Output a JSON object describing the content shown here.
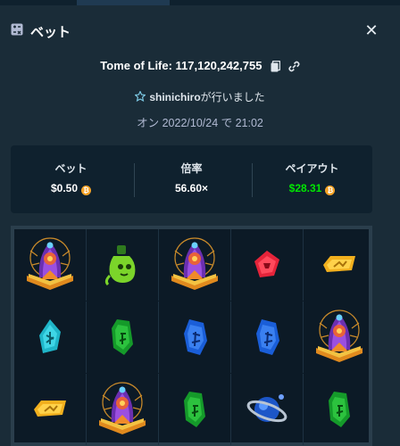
{
  "header": {
    "title": "ベット",
    "close_glyph": "✕"
  },
  "game": {
    "title": "Tome of Life: 117,120,242,755"
  },
  "user": {
    "name": "shinichiro",
    "suffix": "が行いました"
  },
  "date": {
    "text": "オン 2022/10/24 で 21:02"
  },
  "stats": {
    "bet": {
      "label": "ベット",
      "value": "$0.50"
    },
    "multiplier": {
      "label": "倍率",
      "value": "56.60×"
    },
    "payout": {
      "label": "ペイアウト",
      "value": "$28.31"
    }
  },
  "coin_glyph": "₿",
  "colors": {
    "background": "#1a2c38",
    "panel": "#0f212e",
    "payout_green": "#00e701",
    "coin": "#f6a326"
  },
  "reels": [
    [
      "scatter-book",
      "green-potion",
      "scatter-book",
      "red-gem",
      "yellow-gem"
    ],
    [
      "cyan-gem",
      "green-gem",
      "blue-gem",
      "blue-gem",
      "scatter-book"
    ],
    [
      "yellow-gem",
      "scatter-book",
      "green-gem",
      "blue-orb",
      "green-gem"
    ]
  ]
}
